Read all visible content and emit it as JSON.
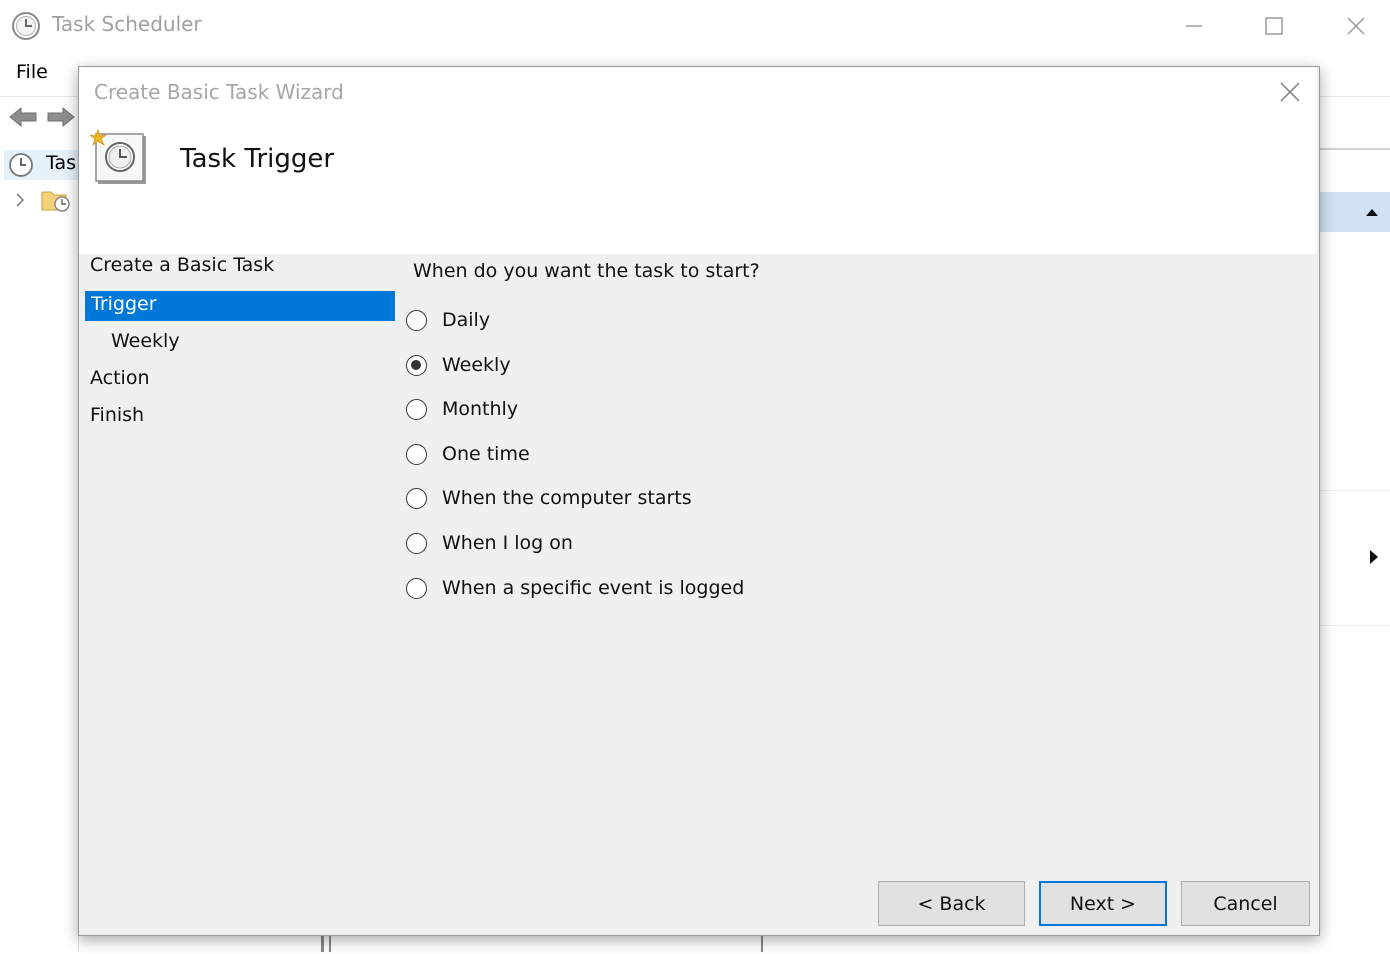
{
  "main_window": {
    "title": "Task Scheduler",
    "menu": {
      "file": "File"
    },
    "tree": {
      "root_label": "Task Scheduler Library"
    },
    "controls": {
      "minimize": "minimize-icon",
      "maximize": "maximize-icon",
      "close": "close-icon"
    }
  },
  "wizard": {
    "title": "Create Basic Task Wizard",
    "heading": "Task Trigger",
    "steps": [
      {
        "label": "Create a Basic Task"
      },
      {
        "label": "Trigger",
        "selected": true
      },
      {
        "label": "Weekly"
      },
      {
        "label": "Action"
      },
      {
        "label": "Finish"
      }
    ],
    "question": "When do you want the task to start?",
    "options": [
      {
        "label": "Daily",
        "checked": false
      },
      {
        "label": "Weekly",
        "checked": true
      },
      {
        "label": "Monthly",
        "checked": false
      },
      {
        "label": "One time",
        "checked": false
      },
      {
        "label": "When the computer starts",
        "checked": false
      },
      {
        "label": "When I log on",
        "checked": false
      },
      {
        "label": "When a specific event is logged",
        "checked": false
      }
    ],
    "buttons": {
      "back": "< Back",
      "next": "Next >",
      "cancel": "Cancel"
    }
  },
  "colors": {
    "selection": "#0078d7",
    "dialog_bg": "#f0f0f0",
    "actions_header": "#cfe3f5"
  }
}
